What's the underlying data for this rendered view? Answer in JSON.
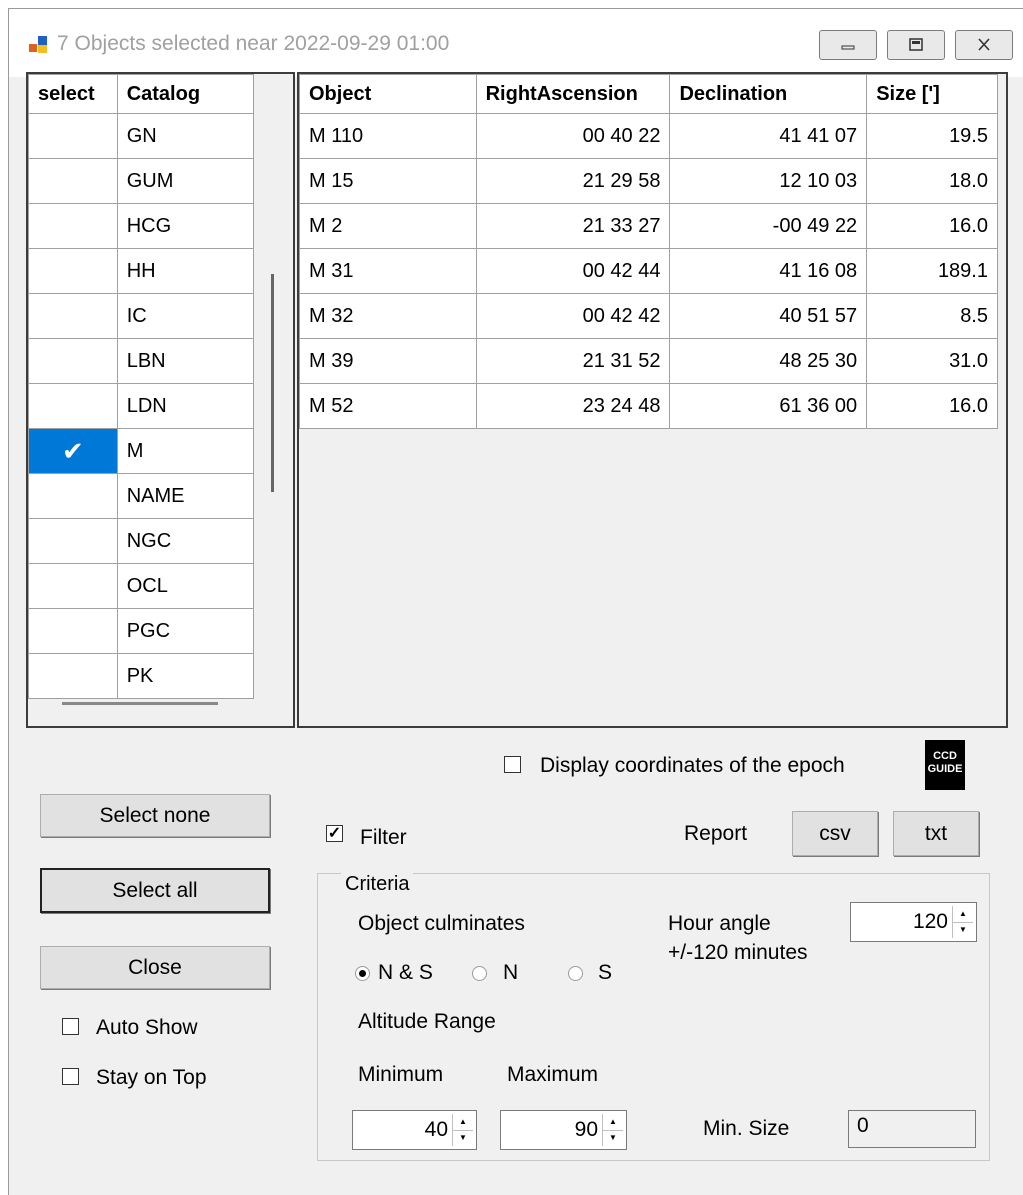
{
  "window": {
    "title": "7 Objects selected near 2022-09-29 01:00"
  },
  "catalog_grid": {
    "headers": {
      "select": "select",
      "catalog": "Catalog"
    },
    "rows": [
      {
        "checked": false,
        "catalog": "GN"
      },
      {
        "checked": false,
        "catalog": "GUM"
      },
      {
        "checked": false,
        "catalog": "HCG"
      },
      {
        "checked": false,
        "catalog": "HH"
      },
      {
        "checked": false,
        "catalog": "IC"
      },
      {
        "checked": false,
        "catalog": "LBN"
      },
      {
        "checked": false,
        "catalog": "LDN"
      },
      {
        "checked": true,
        "catalog": "M"
      },
      {
        "checked": false,
        "catalog": "NAME"
      },
      {
        "checked": false,
        "catalog": "NGC"
      },
      {
        "checked": false,
        "catalog": "OCL"
      },
      {
        "checked": false,
        "catalog": "PGC"
      },
      {
        "checked": false,
        "catalog": "PK"
      }
    ],
    "check_glyph": "✔"
  },
  "object_grid": {
    "headers": {
      "object": "Object",
      "ra": "RightAscension",
      "dec": "Declination",
      "size": "Size [']"
    },
    "rows": [
      {
        "object": "M 110",
        "ra": "00 40 22",
        "dec": "41 41 07",
        "size": "19.5"
      },
      {
        "object": "M 15",
        "ra": "21 29 58",
        "dec": "12 10 03",
        "size": "18.0"
      },
      {
        "object": "M 2",
        "ra": "21 33 27",
        "dec": "-00 49 22",
        "size": "16.0"
      },
      {
        "object": "M 31",
        "ra": "00 42 44",
        "dec": "41 16 08",
        "size": "189.1"
      },
      {
        "object": "M 32",
        "ra": "00 42 42",
        "dec": "40 51 57",
        "size": "8.5"
      },
      {
        "object": "M 39",
        "ra": "21 31 52",
        "dec": "48 25 30",
        "size": "31.0"
      },
      {
        "object": "M 52",
        "ra": "23 24 48",
        "dec": "61 36 00",
        "size": "16.0"
      }
    ]
  },
  "controls": {
    "display_epoch_label": "Display coordinates of the epoch",
    "display_epoch_checked": false,
    "select_none": "Select none",
    "select_all": "Select all",
    "close": "Close",
    "auto_show": "Auto Show",
    "auto_show_checked": false,
    "stay_on_top": "Stay on Top",
    "stay_on_top_checked": false,
    "filter": "Filter",
    "filter_checked": true,
    "report_label": "Report",
    "csv": "csv",
    "txt": "txt",
    "logo_text": "CCD GUIDE"
  },
  "criteria": {
    "legend": "Criteria",
    "object_culminates": "Object culminates",
    "radio_ns": "N & S",
    "radio_n": "N",
    "radio_s": "S",
    "selected_radio": "N & S",
    "hour_angle_label": "Hour angle",
    "hour_angle_range": "+/-120 minutes",
    "hour_angle_value": "120",
    "altitude_range": "Altitude Range",
    "minimum_label": "Minimum",
    "maximum_label": "Maximum",
    "minimum_value": "40",
    "maximum_value": "90",
    "min_size_label": "Min. Size",
    "min_size_value": "0"
  }
}
